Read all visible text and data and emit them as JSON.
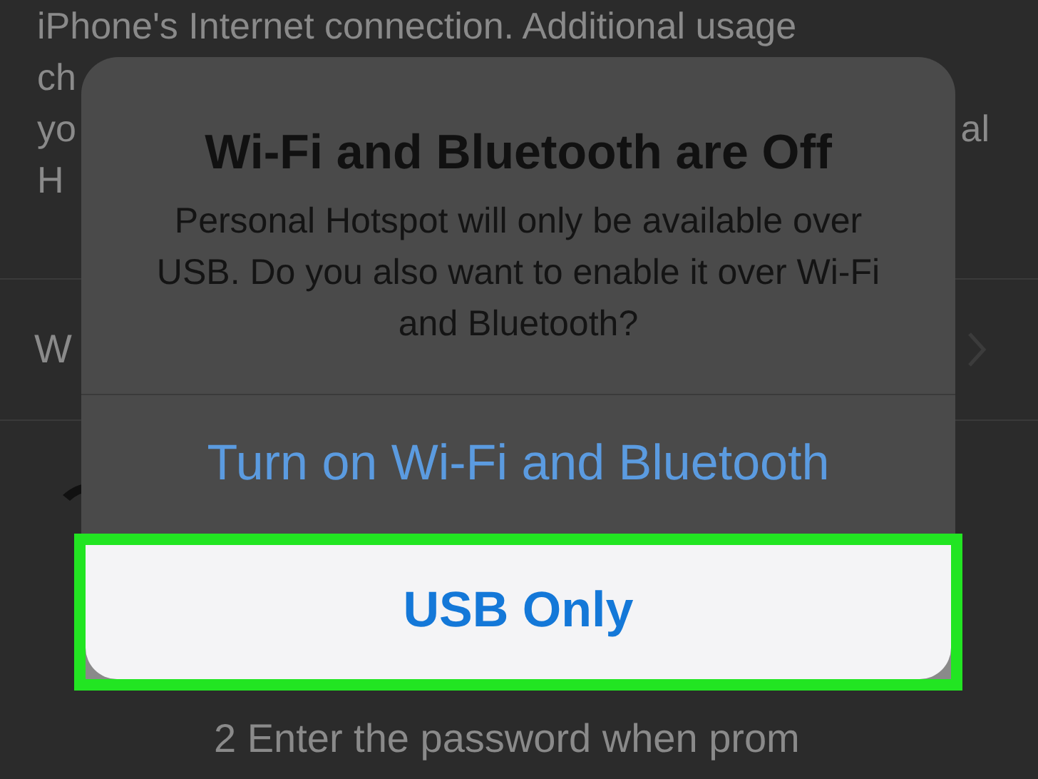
{
  "background": {
    "paragraph_lines": [
      {
        "left": "iPhone's Internet connection. Additional usage"
      },
      {
        "left": "ch"
      },
      {
        "left": "yo",
        "right": "al"
      },
      {
        "left": "H"
      }
    ],
    "row": {
      "label": "W"
    },
    "step": "2 Enter the password when prom"
  },
  "alert": {
    "title": "Wi-Fi and Bluetooth are Off",
    "message": "Personal Hotspot will only be available over USB. Do you also want to enable it over Wi-Fi and Bluetooth?",
    "actions": [
      {
        "label": "Turn on Wi-Fi and Bluetooth",
        "highlighted": false
      },
      {
        "label": "USB Only",
        "highlighted": true
      }
    ]
  }
}
